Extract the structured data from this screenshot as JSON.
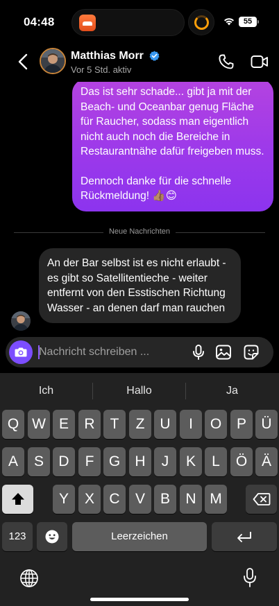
{
  "status_bar": {
    "time": "04:48",
    "battery": "55"
  },
  "header": {
    "name": "Matthias Morr",
    "activity": "Vor 5 Std. aktiv"
  },
  "messages": {
    "outgoing_1_p1": "Das ist sehr schade... gibt ja mit der Beach- und Oceanbar genug Fläche für Raucher, sodass man eigentlich nicht auch noch die Bereiche in Restaurantnähe dafür freigeben muss.",
    "outgoing_1_p2": "Dennoch danke für die schnelle Rückmeldung! 👍🏽😊",
    "divider": "Neue Nachrichten",
    "incoming_1": "An der Bar selbst ist es nicht erlaubt - es gibt so Satellitentieche - weiter entfernt von den Esstischen Richtung Wasser - an denen darf man rauchen"
  },
  "composer": {
    "placeholder": "Nachricht schreiben ..."
  },
  "keyboard": {
    "suggestions": [
      "Ich",
      "Hallo",
      "Ja"
    ],
    "row1": [
      "Q",
      "W",
      "E",
      "R",
      "T",
      "Z",
      "U",
      "I",
      "O",
      "P",
      "Ü"
    ],
    "row2": [
      "A",
      "S",
      "D",
      "F",
      "G",
      "H",
      "J",
      "K",
      "L",
      "Ö",
      "Ä"
    ],
    "row3": [
      "Y",
      "X",
      "C",
      "V",
      "B",
      "N",
      "M"
    ],
    "numbers_key": "123",
    "space_key": "Leerzeichen"
  },
  "icons": {
    "back": "chevron-left-icon",
    "verified": "verified-badge-icon",
    "call": "phone-icon",
    "video": "video-camera-icon",
    "camera": "camera-icon",
    "mic": "microphone-icon",
    "gallery": "image-icon",
    "sticker": "sticker-icon",
    "shift": "shift-icon",
    "delete": "backspace-icon",
    "emoji": "emoji-icon",
    "return": "return-icon",
    "globe": "globe-icon"
  },
  "colors": {
    "accent": "#7c4dff",
    "bubble_out_top": "#b443e0",
    "bubble_out_bottom": "#8c34ee",
    "bubble_in": "#262626",
    "verified": "#3897f0"
  }
}
